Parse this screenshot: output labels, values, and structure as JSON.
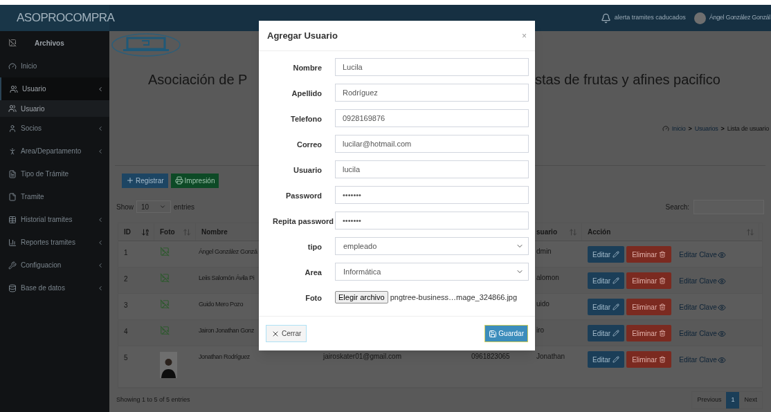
{
  "header": {
    "brand": "ASOPROCOMPRA",
    "alert": "alerta tramites caducados",
    "user": "Ángel González Gonzál"
  },
  "sidebar": {
    "title": "Archivos",
    "items": [
      {
        "label": "Inicio",
        "has_submenu": false,
        "expanded": false
      },
      {
        "label": "Usuario",
        "has_submenu": true,
        "expanded": true,
        "children": [
          {
            "label": "Usuario",
            "selected": true
          }
        ]
      },
      {
        "label": "Socios",
        "has_submenu": true,
        "expanded": false
      },
      {
        "label": "Area/Departamento",
        "has_submenu": true,
        "expanded": false
      },
      {
        "label": "Tipo de Trámite",
        "has_submenu": false,
        "expanded": false
      },
      {
        "label": "Tramite",
        "has_submenu": false,
        "expanded": false
      },
      {
        "label": "Historial tramites",
        "has_submenu": true,
        "expanded": false
      },
      {
        "label": "Reportes tramites",
        "has_submenu": true,
        "expanded": false
      },
      {
        "label": "Configuacion",
        "has_submenu": true,
        "expanded": false
      },
      {
        "label": "Base de datos",
        "has_submenu": true,
        "expanded": false
      }
    ]
  },
  "page": {
    "title_left": "Asociación de P",
    "title_right": "stas de frutas y afines pacifico",
    "breadcrumb": [
      {
        "label": "Inicio"
      },
      {
        "separator": ">",
        "label": "Usuarios"
      },
      {
        "separator": ">",
        "label": "Lista de usuario"
      }
    ],
    "buttons": {
      "register": "Registrar",
      "print": "Impresión"
    },
    "length": {
      "show": "Show",
      "value": "10",
      "entries": "entries"
    },
    "search": {
      "label": "Search:"
    },
    "table": {
      "columns": [
        {
          "kind": "sorted",
          "label": "ID"
        },
        {
          "kind": "sortable",
          "label": "Foto"
        },
        {
          "kind": "plain",
          "label": "Nombre"
        },
        {
          "kind": "sortable",
          "label": "suario"
        },
        {
          "kind": "sortable",
          "label": "Acción"
        }
      ],
      "rows": [
        {
          "kind": "broken-image",
          "id": "1",
          "nombre": "Ángel González Gonzá",
          "usuario": "dmin",
          "edit": "Editar",
          "delete": "Eliminar",
          "password": "Editar Clave"
        },
        {
          "kind": "broken-image",
          "id": "2",
          "nombre": "Leiis Salomón Ávila Pi",
          "usuario": "alomon",
          "edit": "Editar",
          "delete": "Eliminar",
          "password": "Editar Clave"
        },
        {
          "kind": "broken-image",
          "id": "3",
          "nombre": "Guido Mero Pozo",
          "usuario": "uido",
          "edit": "Editar",
          "delete": "Eliminar",
          "password": "Editar Clave"
        },
        {
          "kind": "broken-image",
          "id": "4",
          "nombre": "Jairon Jonathan Gonz",
          "usuario": "iro",
          "edit": "Editar",
          "delete": "Eliminar",
          "password": "Editar Clave"
        },
        {
          "kind": "photo",
          "id": "5",
          "nombre": "Jonathan Rodríguez",
          "correo": "jairoskater01@gmail.com",
          "telefono": "0961823065",
          "usuario": "Jonathan",
          "edit": "Editar",
          "delete": "Eliminar",
          "password": "Editar Clave"
        }
      ]
    },
    "info": "Showing 1 to 5 of 5 entries",
    "pagination": [
      {
        "label": "Previous",
        "selected": false
      },
      {
        "label": "1",
        "selected": true
      },
      {
        "label": "Next",
        "selected": false
      }
    ]
  },
  "modal": {
    "title": "Agregar Usuario",
    "close": "×",
    "fields": [
      {
        "kind": "text",
        "label": "Nombre",
        "value": "Lucila"
      },
      {
        "kind": "text",
        "label": "Apellido",
        "value": "Rodríguez"
      },
      {
        "kind": "text",
        "label": "Telefono",
        "value": "0928169876"
      },
      {
        "kind": "text",
        "label": "Correo",
        "value": "lucilar@hotmail.com"
      },
      {
        "kind": "text",
        "label": "Usuario",
        "value": "lucila"
      },
      {
        "kind": "text",
        "label": "Password",
        "value": "•••••••"
      },
      {
        "kind": "text",
        "label": "Repita password",
        "value": "•••••••"
      },
      {
        "kind": "select",
        "label": "tipo",
        "value": "empleado"
      },
      {
        "kind": "select",
        "label": "Area",
        "value": "Informática"
      },
      {
        "kind": "file",
        "label": "Foto",
        "button": "Elegir archivo",
        "value": "pngtree-business…mage_324866.jpg"
      }
    ],
    "cancel": "Cerrar",
    "save": "Guardar"
  }
}
